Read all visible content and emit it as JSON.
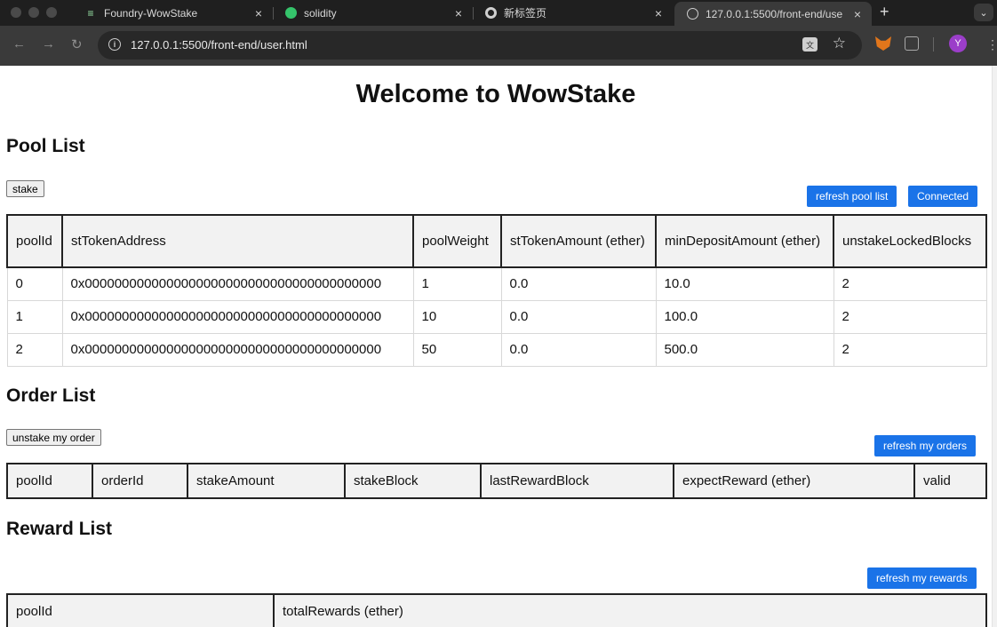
{
  "browser": {
    "tabs": [
      {
        "title": "Foundry-WowStake",
        "icon": "foundry-icon"
      },
      {
        "title": "solidity",
        "icon": "solidity-icon"
      },
      {
        "title": "新标签页",
        "icon": "chrome-icon"
      },
      {
        "title": "127.0.0.1:5500/front-end/use",
        "icon": "globe-icon"
      }
    ],
    "url": "127.0.0.1:5500/front-end/user.html",
    "profile_initial": "Y"
  },
  "page": {
    "title": "Welcome to WowStake",
    "pool_section": {
      "heading": "Pool List",
      "stake_label": "stake",
      "refresh_label": "refresh pool list",
      "connect_label": "Connected",
      "headers": [
        "poolId",
        "stTokenAddress",
        "poolWeight",
        "stTokenAmount (ether)",
        "minDepositAmount (ether)",
        "unstakeLockedBlocks"
      ],
      "rows": [
        [
          "0",
          "0x0000000000000000000000000000000000000000",
          "1",
          "0.0",
          "10.0",
          "2"
        ],
        [
          "1",
          "0x0000000000000000000000000000000000000000",
          "10",
          "0.0",
          "100.0",
          "2"
        ],
        [
          "2",
          "0x0000000000000000000000000000000000000000",
          "50",
          "0.0",
          "500.0",
          "2"
        ]
      ]
    },
    "order_section": {
      "heading": "Order List",
      "unstake_label": "unstake my order",
      "refresh_label": "refresh my orders",
      "headers": [
        "poolId",
        "orderId",
        "stakeAmount",
        "stakeBlock",
        "lastRewardBlock",
        "expectReward (ether)",
        "valid"
      ]
    },
    "reward_section": {
      "heading": "Reward List",
      "refresh_label": "refresh my rewards",
      "headers": [
        "poolId",
        "totalRewards (ether)"
      ]
    }
  },
  "colors": {
    "primary_button": "#1a73e8",
    "header_bg": "#f2f2f2",
    "chrome_dark": "#1f1f1f"
  }
}
